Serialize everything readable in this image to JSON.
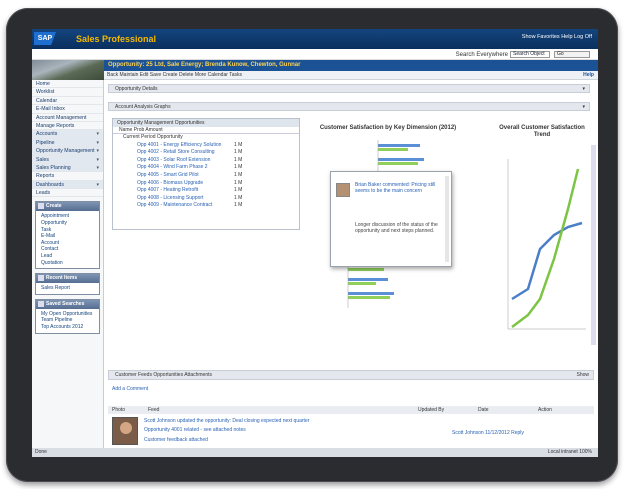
{
  "app": {
    "logo": "SAP",
    "name": "Sales Professional",
    "top_right": "Show Favorites  Help  Log Off"
  },
  "subbar": {
    "search_label": "Search Everywhere",
    "search_value": "Search Object",
    "object_select": "Go"
  },
  "opportunity": {
    "title": "Opportunity: 25 Ltd, Sale Energy; Brenda Kunow, Chewton, Gunnar",
    "toolbar": "Back  Maintain  Edit  Save  Create  Delete  More  Calendar  Tasks",
    "toolbar_right": "Help"
  },
  "sidebar": {
    "items": [
      {
        "label": "Home"
      },
      {
        "label": "Worklist"
      },
      {
        "label": "Calendar"
      },
      {
        "label": "E-Mail Inbox"
      },
      {
        "label": "Account Management"
      },
      {
        "label": "Manage Reports"
      },
      {
        "label": "Accounts",
        "chev": "▾"
      },
      {
        "label": "Pipeline",
        "chev": "▾"
      },
      {
        "label": "Opportunity Management",
        "chev": "▾"
      },
      {
        "label": "Sales",
        "chev": "▾"
      },
      {
        "label": "Sales Planning",
        "chev": "▾"
      },
      {
        "label": "Reports"
      },
      {
        "label": "Dashboards",
        "chev": "▾"
      },
      {
        "label": "Leads"
      }
    ],
    "box1": {
      "title": "Create",
      "items": [
        "Appointment",
        "Opportunity",
        "Task",
        "E-Mail",
        "Account",
        "Contact",
        "Lead",
        "Quotation"
      ]
    },
    "box2": {
      "title": "Recent Items",
      "items": [
        "Sales Report"
      ]
    },
    "box3": {
      "title": "Saved Searches",
      "items": [
        "My Open Opportunities",
        "Team Pipeline",
        "Top Accounts 2012"
      ]
    }
  },
  "main": {
    "panel1": "Opportunity Details",
    "panel2": "Account Analysis  Graphs",
    "list_header": "Opportunity Management Opportunities",
    "list_cols": "Name                          Prob  Amount",
    "list_group": "Current Period  Opportunity",
    "rows": [
      {
        "name": "Opp 4001 - Energy Efficiency Solution",
        "v": "1 M"
      },
      {
        "name": "Opp 4002 - Retail Store Consulting",
        "v": "1 M"
      },
      {
        "name": "Opp 4003 - Solar Roof Extension",
        "v": "1 M"
      },
      {
        "name": "Opp 4004 - Wind Farm Phase 2",
        "v": "1 M"
      },
      {
        "name": "Opp 4005 - Smart Grid Pilot",
        "v": "1 M"
      },
      {
        "name": "Opp 4006 - Biomass Upgrade",
        "v": "1 M"
      },
      {
        "name": "Opp 4007 - Heating Retrofit",
        "v": "1 M"
      },
      {
        "name": "Opp 4008 - Licensing Support",
        "v": "1 M"
      },
      {
        "name": "Opp 4009 - Maintenance Contract",
        "v": "1 M"
      }
    ],
    "chart1_title": "Customer Satisfaction by Key Dimension (2012)",
    "chart1b_title": "Customer",
    "chart2_title": "Overall Customer Satisfaction Trend",
    "popup": {
      "title": "Brian Baker commented: Pricing still seems to be the main concern",
      "body": "Longer discussion of the status of the opportunity and next steps planned."
    }
  },
  "bottom": {
    "head": "Customer Feeds  Opportunities  Attachments",
    "head_right": "Show",
    "link": "Add a Comment",
    "cols": [
      "Photo",
      "Feed",
      "Updated By",
      "Date",
      "Action"
    ],
    "rows": [
      "Scott Johnson updated the opportunity: Deal closing expected next quarter",
      "Opportunity 4001 related - see attached notes",
      "Customer feedback attached"
    ],
    "row_meta": "Scott Johnson   11/12/2012   Reply"
  },
  "status": {
    "left": "Done",
    "right": "Local intranet   100%"
  }
}
